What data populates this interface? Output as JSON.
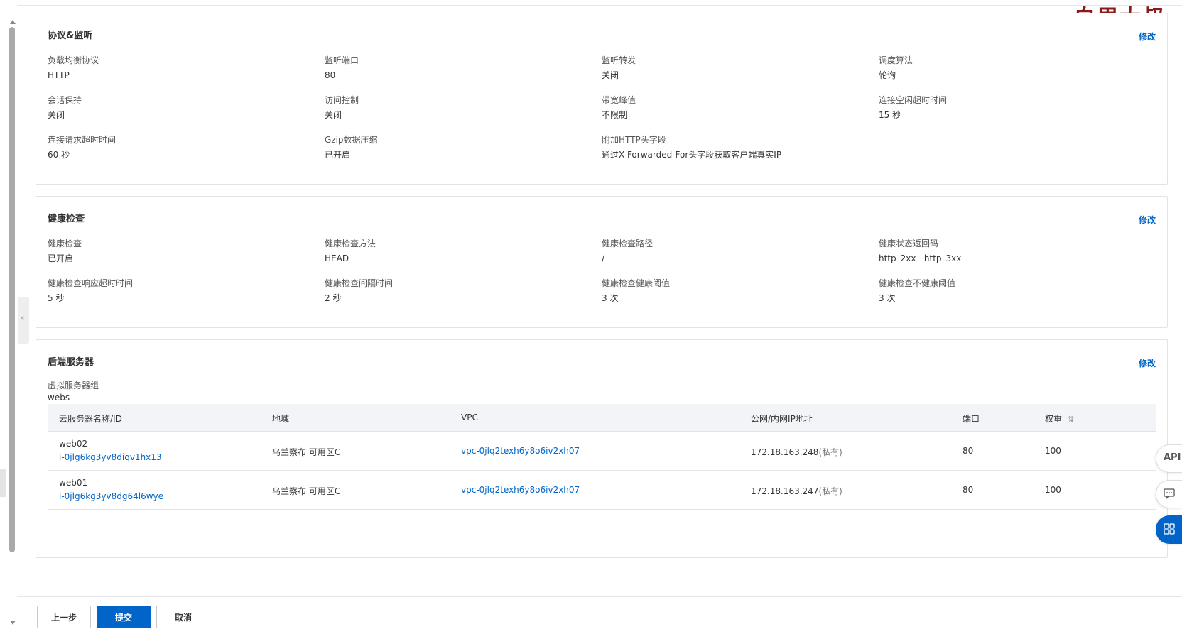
{
  "watermark": "白眉大叔",
  "protocol": {
    "title": "协议&监听",
    "edit": "修改",
    "fields": [
      {
        "label": "负载均衡协议",
        "value": "HTTP"
      },
      {
        "label": "监听端口",
        "value": "80"
      },
      {
        "label": "监听转发",
        "value": "关闭"
      },
      {
        "label": "调度算法",
        "value": "轮询"
      },
      {
        "label": "会话保持",
        "value": "关闭"
      },
      {
        "label": "访问控制",
        "value": "关闭"
      },
      {
        "label": "带宽峰值",
        "value": "不限制"
      },
      {
        "label": "连接空闲超时时间",
        "value": "15 秒"
      },
      {
        "label": "连接请求超时时间",
        "value": "60 秒"
      },
      {
        "label": "Gzip数据压缩",
        "value": "已开启"
      },
      {
        "label": "附加HTTP头字段",
        "value": "通过X-Forwarded-For头字段获取客户端真实IP"
      }
    ]
  },
  "health": {
    "title": "健康检查",
    "edit": "修改",
    "fields": [
      {
        "label": "健康检查",
        "value": "已开启"
      },
      {
        "label": "健康检查方法",
        "value": "HEAD"
      },
      {
        "label": "健康检查路径",
        "value": "/"
      },
      {
        "label": "健康状态返回码",
        "value": "http_2xx   http_3xx"
      },
      {
        "label": "健康检查响应超时时间",
        "value": "5 秒"
      },
      {
        "label": "健康检查间隔时间",
        "value": "2 秒"
      },
      {
        "label": "健康检查健康阈值",
        "value": "3 次"
      },
      {
        "label": "健康检查不健康阈值",
        "value": "3 次"
      }
    ]
  },
  "backend": {
    "title": "后端服务器",
    "edit": "修改",
    "group_label": "虚拟服务器组",
    "group_value": "webs",
    "columns": [
      "云服务器名称/ID",
      "地域",
      "VPC",
      "公网/内网IP地址",
      "端口",
      "权重"
    ],
    "sort_icon": "⇅",
    "rows": [
      {
        "name": "web02",
        "id": "i-0jlg6kg3yv8diqv1hx13",
        "region": "乌兰察布 可用区C",
        "vpc": "vpc-0jlq2texh6y8o6iv2xh07",
        "ip": "172.18.163.248",
        "ip_type": "(私有)",
        "port": "80",
        "weight": "100"
      },
      {
        "name": "web01",
        "id": "i-0jlg6kg3yv8dg64l6wye",
        "region": "乌兰察布 可用区C",
        "vpc": "vpc-0jlq2texh6y8o6iv2xh07",
        "ip": "172.18.163.247",
        "ip_type": "(私有)",
        "port": "80",
        "weight": "100"
      }
    ]
  },
  "footer": {
    "prev": "上一步",
    "submit": "提交",
    "cancel": "取消"
  },
  "tools": {
    "api": "API",
    "chat_icon": "chat-icon",
    "grid_icon": "grid-icon"
  },
  "colors": {
    "accent": "#0064c8",
    "watermark": "#8b1a1a"
  }
}
